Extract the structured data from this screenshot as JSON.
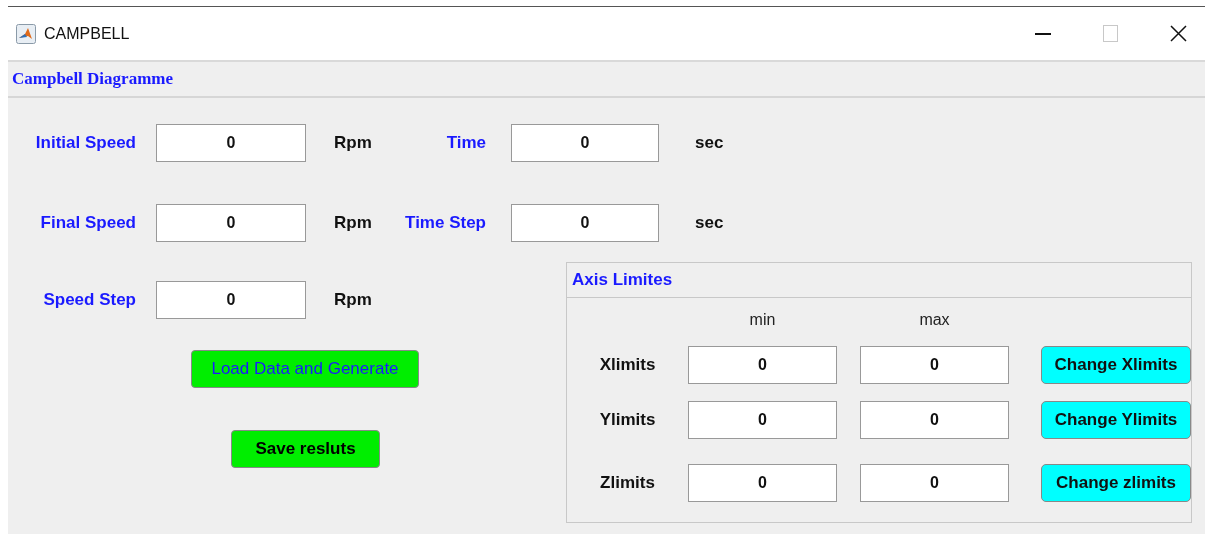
{
  "window": {
    "title": "CAMPBELL"
  },
  "panel": {
    "title": "Campbell Diagramme"
  },
  "parameters": [
    {
      "label": "Initial Speed",
      "value": "0",
      "unit": "Rpm"
    },
    {
      "label": "Time",
      "value": "0",
      "unit": "sec"
    },
    {
      "label": "Final Speed",
      "value": "0",
      "unit": "Rpm"
    },
    {
      "label": "Time Step",
      "value": "0",
      "unit": "sec"
    },
    {
      "label": "Speed Step",
      "value": "0",
      "unit": "Rpm"
    }
  ],
  "buttons": [
    {
      "label": "Load Data and Generate"
    },
    {
      "label": "Save resluts"
    }
  ],
  "axis_limits": {
    "title": "Axis Limites",
    "columns": [
      "min",
      "max"
    ],
    "rows": [
      {
        "label": "Xlimits",
        "min": "0",
        "max": "0",
        "button": "Change Xlimits"
      },
      {
        "label": "Ylimits",
        "min": "0",
        "max": "0",
        "button": "Change Ylimits"
      },
      {
        "label": "Zlimits",
        "min": "0",
        "max": "0",
        "button": "Change zlimits"
      }
    ]
  }
}
